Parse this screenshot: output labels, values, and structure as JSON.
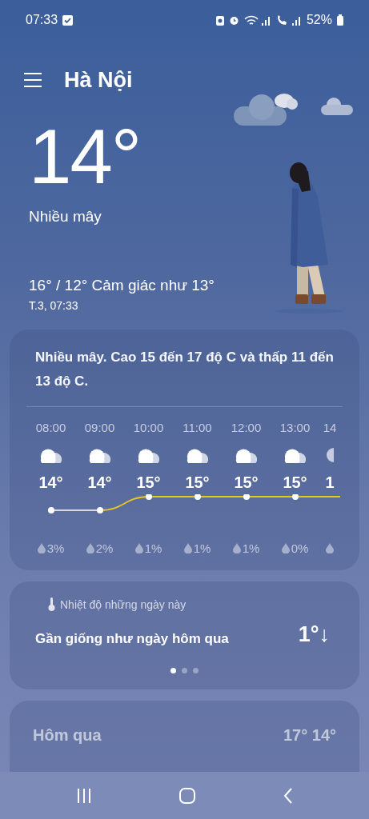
{
  "status_bar": {
    "time": "07:33",
    "battery": "52%"
  },
  "location": {
    "name": "Hà Nội"
  },
  "current": {
    "temperature": "14°",
    "condition": "Nhiều mây",
    "range": "16° / 12° Cảm giác như 13°",
    "updated": "T.3, 07:33"
  },
  "forecast_card": {
    "summary": "Nhiều mây. Cao 15 đến 17 độ C và thấp 11 đến 13 độ C.",
    "hours": [
      {
        "kind": "hour",
        "time": "08:00",
        "temp": "14°",
        "precip": "3%"
      },
      {
        "kind": "hour",
        "time": "09:00",
        "temp": "14°",
        "precip": "2%"
      },
      {
        "kind": "hour",
        "time": "10:00",
        "temp": "15°",
        "precip": "1%"
      },
      {
        "kind": "hour",
        "time": "11:00",
        "temp": "15°",
        "precip": "1%"
      },
      {
        "kind": "hour",
        "time": "12:00",
        "temp": "15°",
        "precip": "1%"
      },
      {
        "kind": "hour",
        "time": "13:00",
        "temp": "15°",
        "precip": "0%"
      },
      {
        "kind": "cut",
        "time": "14",
        "temp": "1"
      }
    ]
  },
  "comparison_card": {
    "title": "Nhiệt độ những ngày này",
    "message": "Gần giống như ngày hôm qua",
    "difference": "1°↓",
    "pages": [
      {
        "selected": true
      },
      {
        "selected": false
      },
      {
        "selected": false
      }
    ]
  },
  "daily_card": {
    "rows": [
      {
        "kind": "yesterday",
        "day": "Hôm qua",
        "temps": "17° 14°"
      }
    ]
  }
}
